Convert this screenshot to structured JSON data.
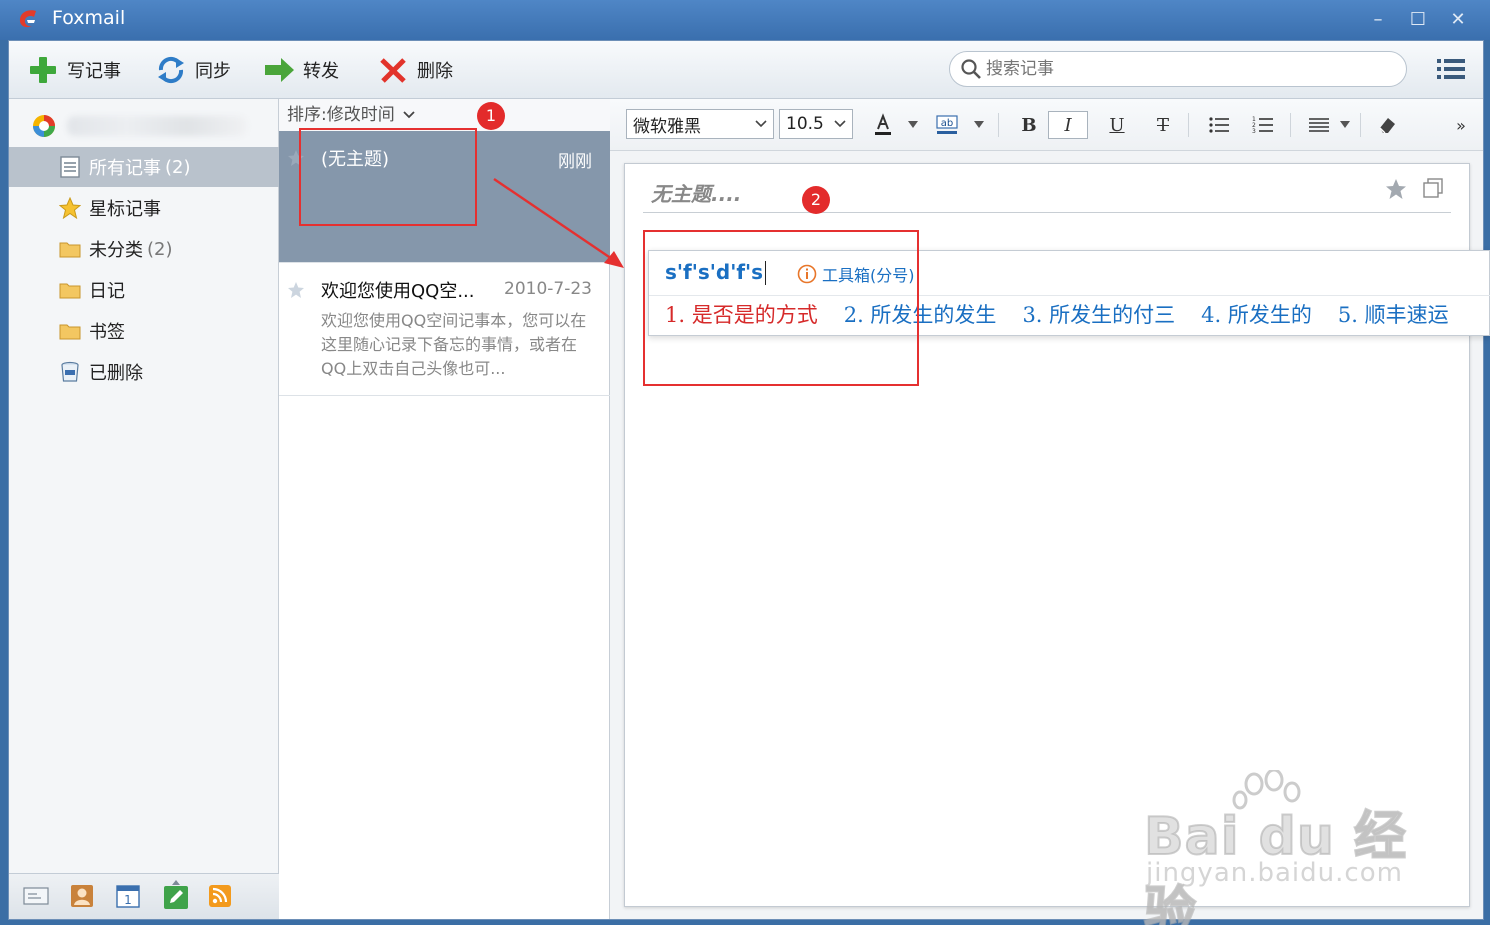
{
  "window": {
    "title": "Foxmail"
  },
  "toolbar": {
    "compose": "写记事",
    "sync": "同步",
    "forward": "转发",
    "delete": "删除",
    "search_placeholder": "搜索记事"
  },
  "sidebar": {
    "items": [
      {
        "label": "所有记事",
        "count": "(2)",
        "icon": "note-list-icon"
      },
      {
        "label": "星标记事",
        "count": "",
        "icon": "star-icon"
      },
      {
        "label": "未分类",
        "count": "(2)",
        "icon": "folder-icon"
      },
      {
        "label": "日记",
        "count": "",
        "icon": "folder-icon"
      },
      {
        "label": "书签",
        "count": "",
        "icon": "folder-icon"
      },
      {
        "label": "已删除",
        "count": "",
        "icon": "trash-icon"
      }
    ],
    "footer_icons": [
      "mail-icon",
      "contacts-icon",
      "calendar-icon",
      "notes-icon",
      "rss-icon"
    ]
  },
  "notelist": {
    "sort_label": "排序:修改时间",
    "notes": [
      {
        "title": "(无主题)",
        "date": "刚刚",
        "body": ""
      },
      {
        "title": "欢迎您使用QQ空...",
        "date": "2010-7-23",
        "body": "欢迎您使用QQ空间记事本，您可以在这里随心记录下备忘的事情，或者在QQ上双击自己头像也可..."
      }
    ]
  },
  "editor": {
    "font_family": "微软雅黑",
    "font_size": "10.5",
    "subject_placeholder": "无主题....",
    "fmt": {
      "bold": "B",
      "italic": "I",
      "underline": "U",
      "strike": "T",
      "more": "»"
    }
  },
  "ime": {
    "composition": "s'f's'd'f's",
    "toolbox": "工具箱(分号)",
    "candidates": [
      "1. 是否是的方式",
      "2. 所发生的发生",
      "3. 所发生的付三",
      "4. 所发生的",
      "5. 顺丰速运"
    ]
  },
  "annotations": {
    "badge1": "1",
    "badge2": "2"
  },
  "watermark": {
    "main": "Bai du 经验",
    "sub": "jingyan.baidu.com"
  },
  "colors": {
    "accent_blue": "#1a6fc2",
    "annotation_red": "#e53030",
    "selected_row": "#8597ab"
  }
}
